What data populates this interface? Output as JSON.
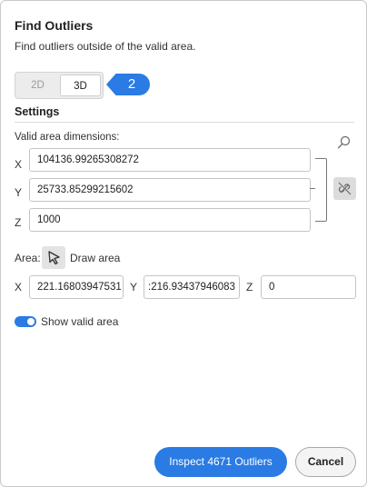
{
  "dialog": {
    "title": "Find Outliers",
    "subtitle": "Find outliers outside of the valid area."
  },
  "mode": {
    "options": [
      "2D",
      "3D"
    ],
    "selected": "3D",
    "callout_number": "2"
  },
  "settings": {
    "section_title": "Settings",
    "valid_area_label": "Valid area dimensions:",
    "dimensions": {
      "x_label": "X",
      "x_value": "104136.99265308272",
      "y_label": "Y",
      "y_value": "25733.85299215602",
      "z_label": "Z",
      "z_value": "1000"
    }
  },
  "area": {
    "label": "Area:",
    "draw_label": "Draw area",
    "x_label": "X",
    "x_value": "221.16803947531",
    "y_label": "Y",
    "y_value": ":216.93437946083",
    "z_label": "Z",
    "z_value": "0"
  },
  "show_valid_area": {
    "label": "Show valid area",
    "enabled": true
  },
  "footer": {
    "primary_label": "Inspect 4671 Outliers",
    "cancel_label": "Cancel"
  },
  "colors": {
    "accent": "#2a7be4"
  },
  "icons": {
    "search": "search-icon",
    "link": "unlink-icon",
    "draw_area": "cursor-select-icon"
  }
}
